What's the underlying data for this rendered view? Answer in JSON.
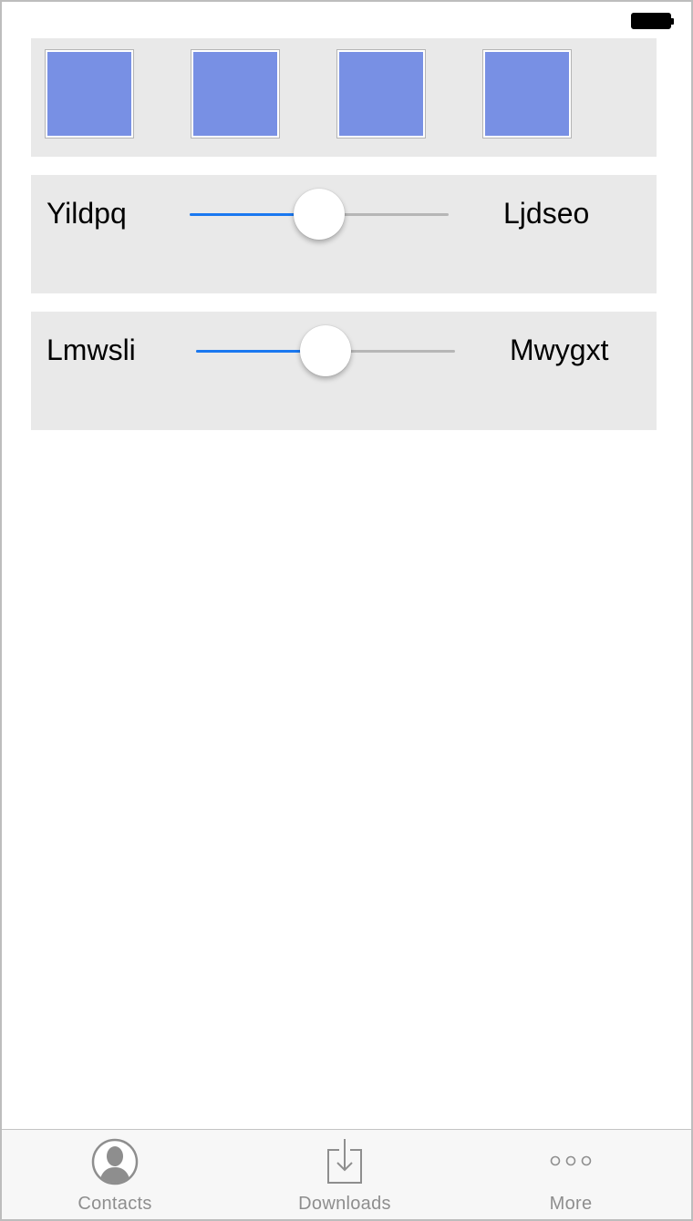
{
  "panels": {
    "squares": {
      "count": 4,
      "fill_color": "#7890e4"
    },
    "slider1": {
      "left_label": "Yildpq",
      "right_label": "Ljdseo",
      "value_fraction": 0.5
    },
    "slider2": {
      "left_label": "Lmwsli",
      "right_label": "Mwygxt",
      "value_fraction": 0.5
    }
  },
  "tabbar": {
    "tabs": [
      {
        "label": "Contacts",
        "icon": "contacts-icon"
      },
      {
        "label": "Downloads",
        "icon": "downloads-icon"
      },
      {
        "label": "More",
        "icon": "more-icon"
      }
    ]
  },
  "colors": {
    "accent": "#1a78f0",
    "panel_bg": "#e9e9e9",
    "tab_label": "#8e8e8e"
  }
}
